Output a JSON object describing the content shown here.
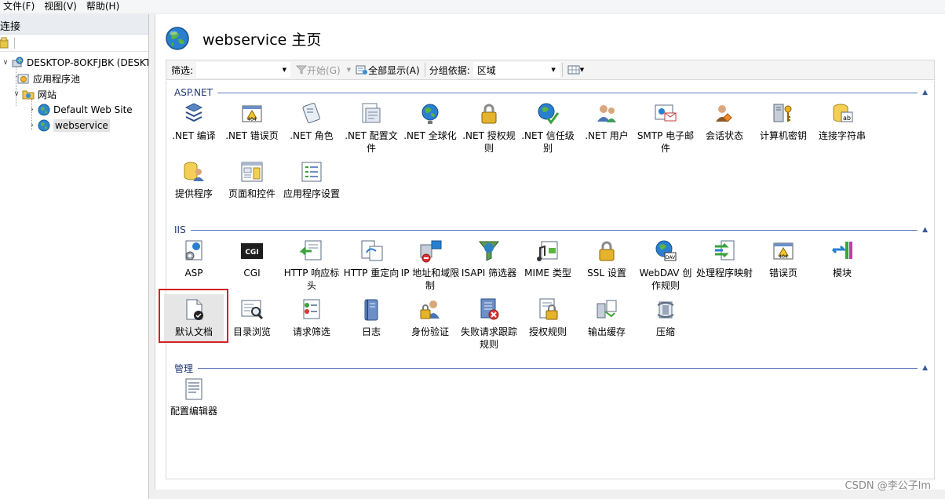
{
  "menu": [
    "文件(F)",
    "视图(V)",
    "帮助(H)"
  ],
  "connections": {
    "header": "连接",
    "tree": {
      "server": "DESKTOP-8OKFJBK (DESKTO",
      "app_pools": "应用程序池",
      "sites": "网站",
      "default_site": "Default Web Site",
      "webservice": "webservice"
    }
  },
  "page": {
    "title": "webservice 主页"
  },
  "filter": {
    "label": "筛选:",
    "value": "",
    "go_label": "开始(G)",
    "show_all_label": "全部显示(A)",
    "group_by_label": "分组依据:",
    "group_by_value": "区域"
  },
  "groups": {
    "aspnet": {
      "title": "ASP.NET",
      "items": [
        ".NET 编译",
        ".NET 错误页",
        ".NET 角色",
        ".NET 配置文件",
        ".NET 全球化",
        ".NET 授权规则",
        ".NET 信任级别",
        ".NET 用户",
        "SMTP 电子邮件",
        "会话状态",
        "计算机密钥",
        "连接字符串",
        "提供程序",
        "页面和控件",
        "应用程序设置"
      ]
    },
    "iis": {
      "title": "IIS",
      "items": [
        "ASP",
        "CGI",
        "HTTP 响应标头",
        "HTTP 重定向",
        "IP 地址和域限制",
        "ISAPI 筛选器",
        "MIME 类型",
        "SSL 设置",
        "WebDAV 创作规则",
        "处理程序映射",
        "错误页",
        "模块",
        "默认文档",
        "目录浏览",
        "请求筛选",
        "日志",
        "身份验证",
        "失败请求跟踪规则",
        "授权规则",
        "输出缓存",
        "压缩"
      ]
    },
    "management": {
      "title": "管理",
      "items": [
        "配置编辑器"
      ]
    }
  },
  "watermark": "CSDN @李公子lm",
  "colors": {
    "group_title": "#1f3a74",
    "group_line": "#5c7cbf",
    "selection_border": "#d32323"
  }
}
